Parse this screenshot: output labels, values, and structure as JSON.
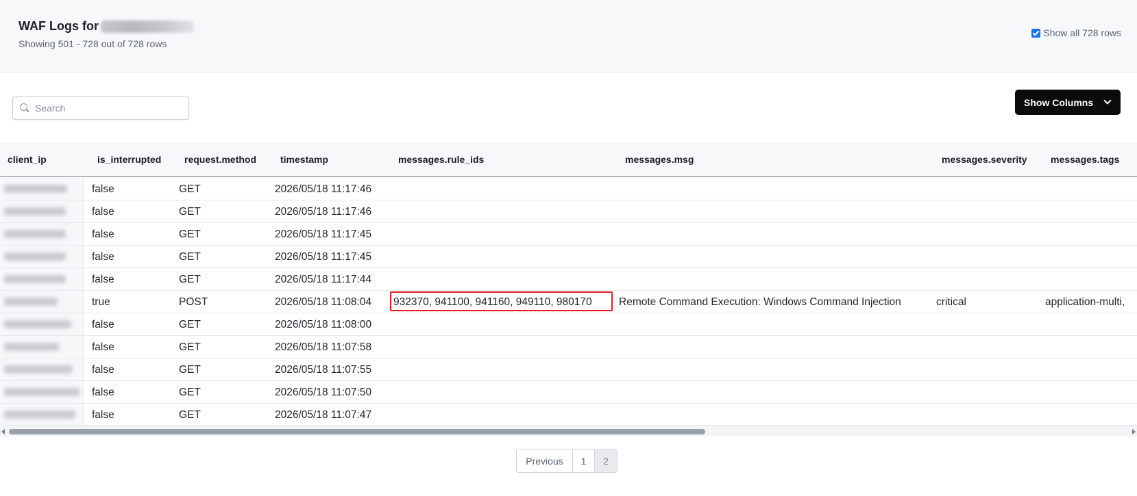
{
  "header": {
    "title": "WAF Logs for",
    "subtitle": "Showing 501 - 728 out of 728 rows",
    "show_all_label": "Show all 728 rows",
    "show_all_checked": true
  },
  "toolbar": {
    "search_placeholder": "Search",
    "show_columns_label": "Show Columns"
  },
  "table": {
    "columns": [
      "client_ip",
      "is_interrupted",
      "request.method",
      "timestamp",
      "messages.rule_ids",
      "messages.msg",
      "messages.severity",
      "messages.tags"
    ],
    "rows": [
      {
        "is_interrupted": "false",
        "method": "GET",
        "timestamp": "2026/05/18 11:17:46",
        "rule_ids": "",
        "msg": "",
        "severity": "",
        "tags": ""
      },
      {
        "is_interrupted": "false",
        "method": "GET",
        "timestamp": "2026/05/18 11:17:46",
        "rule_ids": "",
        "msg": "",
        "severity": "",
        "tags": ""
      },
      {
        "is_interrupted": "false",
        "method": "GET",
        "timestamp": "2026/05/18 11:17:45",
        "rule_ids": "",
        "msg": "",
        "severity": "",
        "tags": ""
      },
      {
        "is_interrupted": "false",
        "method": "GET",
        "timestamp": "2026/05/18 11:17:45",
        "rule_ids": "",
        "msg": "",
        "severity": "",
        "tags": ""
      },
      {
        "is_interrupted": "false",
        "method": "GET",
        "timestamp": "2026/05/18 11:17:44",
        "rule_ids": "",
        "msg": "",
        "severity": "",
        "tags": ""
      },
      {
        "is_interrupted": "true",
        "method": "POST",
        "timestamp": "2026/05/18 11:08:04",
        "rule_ids": "932370, 941100, 941160, 949110, 980170",
        "msg": "Remote Command Execution: Windows Command Injection",
        "severity": "critical",
        "tags": "application-multi,",
        "highlighted": true
      },
      {
        "is_interrupted": "false",
        "method": "GET",
        "timestamp": "2026/05/18 11:08:00",
        "rule_ids": "",
        "msg": "",
        "severity": "",
        "tags": ""
      },
      {
        "is_interrupted": "false",
        "method": "GET",
        "timestamp": "2026/05/18 11:07:58",
        "rule_ids": "",
        "msg": "",
        "severity": "",
        "tags": ""
      },
      {
        "is_interrupted": "false",
        "method": "GET",
        "timestamp": "2026/05/18 11:07:55",
        "rule_ids": "",
        "msg": "",
        "severity": "",
        "tags": ""
      },
      {
        "is_interrupted": "false",
        "method": "GET",
        "timestamp": "2026/05/18 11:07:50",
        "rule_ids": "",
        "msg": "",
        "severity": "",
        "tags": ""
      },
      {
        "is_interrupted": "false",
        "method": "GET",
        "timestamp": "2026/05/18 11:07:47",
        "rule_ids": "",
        "msg": "",
        "severity": "",
        "tags": ""
      }
    ]
  },
  "pagination": {
    "previous_label": "Previous",
    "pages": [
      "1",
      "2"
    ],
    "current_page": "2"
  },
  "colors": {
    "highlight_border": "#e21d25",
    "primary_button": "#0b0b0c",
    "checkbox_accent": "#1a73e8"
  }
}
